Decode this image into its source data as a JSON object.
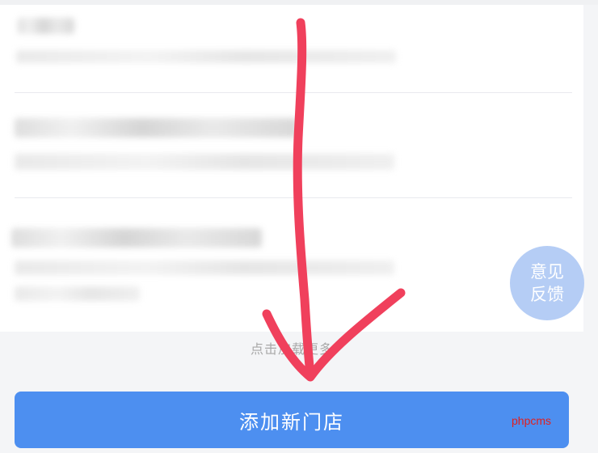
{
  "store_list": {
    "footer_hint": "点击加载更多"
  },
  "feedback_button": {
    "line1": "意见",
    "line2": "反馈"
  },
  "primary_action": {
    "label": "添加新门店"
  },
  "watermark": "phpcms",
  "colors": {
    "primary_blue": "#4d8ff0",
    "feedback_bubble": "#b5cdf5",
    "annotation_arrow": "#f0405c",
    "watermark_red": "#e02020"
  },
  "icons": {
    "annotation": "down-arrow-icon"
  }
}
